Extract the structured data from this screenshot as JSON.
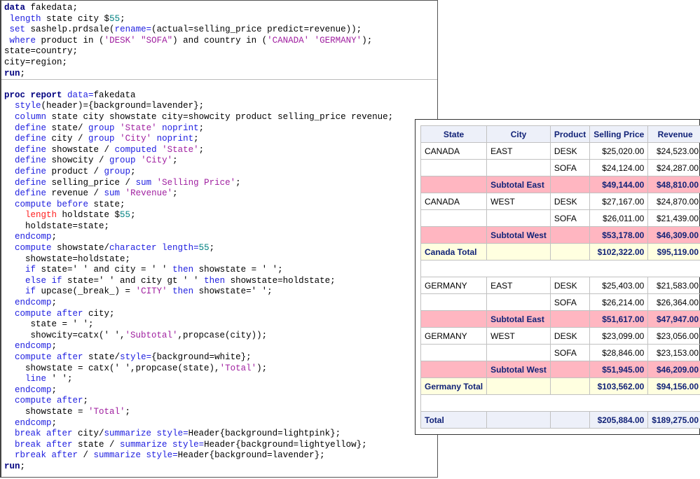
{
  "code_lines": [
    [
      [
        "data",
        "k"
      ],
      [
        " fakedata;",
        "t"
      ]
    ],
    [
      [
        " ",
        "t"
      ],
      [
        "length",
        "b"
      ],
      [
        " state city $",
        "t"
      ],
      [
        "55",
        "n"
      ],
      [
        ";",
        "t"
      ]
    ],
    [
      [
        " ",
        "t"
      ],
      [
        "set",
        "b"
      ],
      [
        " sashelp.prdsale(",
        "t"
      ],
      [
        "rename=",
        "b"
      ],
      [
        "(actual=selling_price predict=revenue));",
        "t"
      ]
    ],
    [
      [
        " ",
        "t"
      ],
      [
        "where",
        "b"
      ],
      [
        " product in (",
        "t"
      ],
      [
        "'DESK'",
        "s"
      ],
      [
        " ",
        "t"
      ],
      [
        "\"SOFA\"",
        "s"
      ],
      [
        ") and country in (",
        "t"
      ],
      [
        "'CANADA'",
        "s"
      ],
      [
        " ",
        "t"
      ],
      [
        "'GERMANY'",
        "s"
      ],
      [
        ");",
        "t"
      ]
    ],
    [
      [
        "state=country;",
        "t"
      ]
    ],
    [
      [
        "city=region;",
        "t"
      ]
    ],
    [
      [
        "run",
        "k"
      ],
      [
        ";",
        "t"
      ]
    ],
    [],
    [
      [
        "proc report",
        "k"
      ],
      [
        " ",
        "t"
      ],
      [
        "data=",
        "b"
      ],
      [
        "fakedata",
        "t"
      ]
    ],
    [
      [
        "  ",
        "t"
      ],
      [
        "style",
        "b"
      ],
      [
        "(header)={background=lavender};",
        "t"
      ]
    ],
    [
      [
        "  ",
        "t"
      ],
      [
        "column",
        "b"
      ],
      [
        " state city showstate city=showcity product selling_price revenue;",
        "t"
      ]
    ],
    [
      [
        "  ",
        "t"
      ],
      [
        "define",
        "b"
      ],
      [
        " state/ ",
        "t"
      ],
      [
        "group",
        "b"
      ],
      [
        " ",
        "t"
      ],
      [
        "'State'",
        "s"
      ],
      [
        " ",
        "t"
      ],
      [
        "noprint",
        "b"
      ],
      [
        ";",
        "t"
      ]
    ],
    [
      [
        "  ",
        "t"
      ],
      [
        "define",
        "b"
      ],
      [
        " city / ",
        "t"
      ],
      [
        "group",
        "b"
      ],
      [
        " ",
        "t"
      ],
      [
        "'City'",
        "s"
      ],
      [
        " ",
        "t"
      ],
      [
        "noprint",
        "b"
      ],
      [
        ";",
        "t"
      ]
    ],
    [
      [
        "  ",
        "t"
      ],
      [
        "define",
        "b"
      ],
      [
        " showstate / ",
        "t"
      ],
      [
        "computed",
        "b"
      ],
      [
        " ",
        "t"
      ],
      [
        "'State'",
        "s"
      ],
      [
        ";",
        "t"
      ]
    ],
    [
      [
        "  ",
        "t"
      ],
      [
        "define",
        "b"
      ],
      [
        " showcity / ",
        "t"
      ],
      [
        "group",
        "b"
      ],
      [
        " ",
        "t"
      ],
      [
        "'City'",
        "s"
      ],
      [
        ";",
        "t"
      ]
    ],
    [
      [
        "  ",
        "t"
      ],
      [
        "define",
        "b"
      ],
      [
        " product / ",
        "t"
      ],
      [
        "group",
        "b"
      ],
      [
        ";",
        "t"
      ]
    ],
    [
      [
        "  ",
        "t"
      ],
      [
        "define",
        "b"
      ],
      [
        " selling_price / ",
        "t"
      ],
      [
        "sum",
        "b"
      ],
      [
        " ",
        "t"
      ],
      [
        "'Selling Price'",
        "s"
      ],
      [
        ";",
        "t"
      ]
    ],
    [
      [
        "  ",
        "t"
      ],
      [
        "define",
        "b"
      ],
      [
        " revenue / ",
        "t"
      ],
      [
        "sum",
        "b"
      ],
      [
        " ",
        "t"
      ],
      [
        "'Revenue'",
        "s"
      ],
      [
        ";",
        "t"
      ]
    ],
    [
      [
        "  ",
        "t"
      ],
      [
        "compute before",
        "b"
      ],
      [
        " state;",
        "t"
      ]
    ],
    [
      [
        "    ",
        "t"
      ],
      [
        "length",
        "r"
      ],
      [
        " holdstate $",
        "t"
      ],
      [
        "55",
        "n"
      ],
      [
        ";",
        "t"
      ]
    ],
    [
      [
        "    holdstate=state;",
        "t"
      ]
    ],
    [
      [
        "  ",
        "t"
      ],
      [
        "endcomp",
        "b"
      ],
      [
        ";",
        "t"
      ]
    ],
    [
      [
        "  ",
        "t"
      ],
      [
        "compute",
        "b"
      ],
      [
        " showstate/",
        "t"
      ],
      [
        "character length=",
        "b"
      ],
      [
        "55",
        "n"
      ],
      [
        ";",
        "t"
      ]
    ],
    [
      [
        "    showstate=holdstate;",
        "t"
      ]
    ],
    [
      [
        "    ",
        "t"
      ],
      [
        "if",
        "b"
      ],
      [
        " state=' ' and city = ' ' ",
        "t"
      ],
      [
        "then",
        "b"
      ],
      [
        " showstate = ' ';",
        "t"
      ]
    ],
    [
      [
        "    ",
        "t"
      ],
      [
        "else if",
        "b"
      ],
      [
        " state=' ' and city gt ' ' ",
        "t"
      ],
      [
        "then",
        "b"
      ],
      [
        " showstate=holdstate;",
        "t"
      ]
    ],
    [
      [
        "    ",
        "t"
      ],
      [
        "if",
        "b"
      ],
      [
        " upcase(_break_) = ",
        "t"
      ],
      [
        "'CITY'",
        "s"
      ],
      [
        " ",
        "t"
      ],
      [
        "then",
        "b"
      ],
      [
        " showstate=' ';",
        "t"
      ]
    ],
    [
      [
        "  ",
        "t"
      ],
      [
        "endcomp",
        "b"
      ],
      [
        ";",
        "t"
      ]
    ],
    [
      [
        "  ",
        "t"
      ],
      [
        "compute after",
        "b"
      ],
      [
        " city;",
        "t"
      ]
    ],
    [
      [
        "     state = ' ';",
        "t"
      ]
    ],
    [
      [
        "     showcity=catx(' ',",
        "t"
      ],
      [
        "'Subtotal'",
        "s"
      ],
      [
        ",propcase(city));",
        "t"
      ]
    ],
    [
      [
        "  ",
        "t"
      ],
      [
        "endcomp",
        "b"
      ],
      [
        ";",
        "t"
      ]
    ],
    [
      [
        "  ",
        "t"
      ],
      [
        "compute after",
        "b"
      ],
      [
        " state/",
        "t"
      ],
      [
        "style=",
        "b"
      ],
      [
        "{background=white};",
        "t"
      ]
    ],
    [
      [
        "    showstate = catx(' ',propcase(state),",
        "t"
      ],
      [
        "'Total'",
        "s"
      ],
      [
        ");",
        "t"
      ]
    ],
    [
      [
        "    ",
        "t"
      ],
      [
        "line",
        "b"
      ],
      [
        " ' ';",
        "t"
      ]
    ],
    [
      [
        "  ",
        "t"
      ],
      [
        "endcomp",
        "b"
      ],
      [
        ";",
        "t"
      ]
    ],
    [
      [
        "  ",
        "t"
      ],
      [
        "compute after",
        "b"
      ],
      [
        ";",
        "t"
      ]
    ],
    [
      [
        "    showstate = ",
        "t"
      ],
      [
        "'Total'",
        "s"
      ],
      [
        ";",
        "t"
      ]
    ],
    [
      [
        "  ",
        "t"
      ],
      [
        "endcomp",
        "b"
      ],
      [
        ";",
        "t"
      ]
    ],
    [
      [
        "  ",
        "t"
      ],
      [
        "break after",
        "b"
      ],
      [
        " city/",
        "t"
      ],
      [
        "summarize style=",
        "b"
      ],
      [
        "Header{background=lightpink};",
        "t"
      ]
    ],
    [
      [
        "  ",
        "t"
      ],
      [
        "break after",
        "b"
      ],
      [
        " state / ",
        "t"
      ],
      [
        "summarize style=",
        "b"
      ],
      [
        "Header{background=lightyellow};",
        "t"
      ]
    ],
    [
      [
        "  ",
        "t"
      ],
      [
        "rbreak after",
        "b"
      ],
      [
        " / ",
        "t"
      ],
      [
        "summarize style=",
        "b"
      ],
      [
        "Header{background=lavender};",
        "t"
      ]
    ],
    [
      [
        "run",
        "k"
      ],
      [
        ";",
        "t"
      ]
    ]
  ],
  "report": {
    "headers": [
      "State",
      "City",
      "Product",
      "Selling Price",
      "Revenue"
    ],
    "rows": [
      {
        "type": "detail",
        "cells": [
          "CANADA",
          "EAST",
          "DESK",
          "$25,020.00",
          "$24,523.00"
        ]
      },
      {
        "type": "detail",
        "cells": [
          "",
          "",
          "SOFA",
          "$24,124.00",
          "$24,287.00"
        ]
      },
      {
        "type": "sub",
        "cells": [
          "",
          "Subtotal East",
          "",
          "$49,144.00",
          "$48,810.00"
        ]
      },
      {
        "type": "detail",
        "cells": [
          "CANADA",
          "WEST",
          "DESK",
          "$27,167.00",
          "$24,870.00"
        ]
      },
      {
        "type": "detail",
        "cells": [
          "",
          "",
          "SOFA",
          "$26,011.00",
          "$21,439.00"
        ]
      },
      {
        "type": "sub",
        "cells": [
          "",
          "Subtotal West",
          "",
          "$53,178.00",
          "$46,309.00"
        ]
      },
      {
        "type": "tot",
        "cells": [
          "Canada Total",
          "",
          "",
          "$102,322.00",
          "$95,119.00"
        ]
      },
      {
        "type": "blank",
        "cells": []
      },
      {
        "type": "detail",
        "cells": [
          "GERMANY",
          "EAST",
          "DESK",
          "$25,403.00",
          "$21,583.00"
        ]
      },
      {
        "type": "detail",
        "cells": [
          "",
          "",
          "SOFA",
          "$26,214.00",
          "$26,364.00"
        ]
      },
      {
        "type": "sub",
        "cells": [
          "",
          "Subtotal East",
          "",
          "$51,617.00",
          "$47,947.00"
        ]
      },
      {
        "type": "detail",
        "cells": [
          "GERMANY",
          "WEST",
          "DESK",
          "$23,099.00",
          "$23,056.00"
        ]
      },
      {
        "type": "detail",
        "cells": [
          "",
          "",
          "SOFA",
          "$28,846.00",
          "$23,153.00"
        ]
      },
      {
        "type": "sub",
        "cells": [
          "",
          "Subtotal West",
          "",
          "$51,945.00",
          "$46,209.00"
        ]
      },
      {
        "type": "tot",
        "cells": [
          "Germany Total",
          "",
          "",
          "$103,562.00",
          "$94,156.00"
        ]
      },
      {
        "type": "blank",
        "cells": []
      },
      {
        "type": "grand",
        "cells": [
          "Total",
          "",
          "",
          "$205,884.00",
          "$189,275.00"
        ]
      }
    ],
    "colors": {
      "header": "#edf0f9",
      "subtotal": "#ffb6c1",
      "total": "#ffffe0"
    }
  }
}
